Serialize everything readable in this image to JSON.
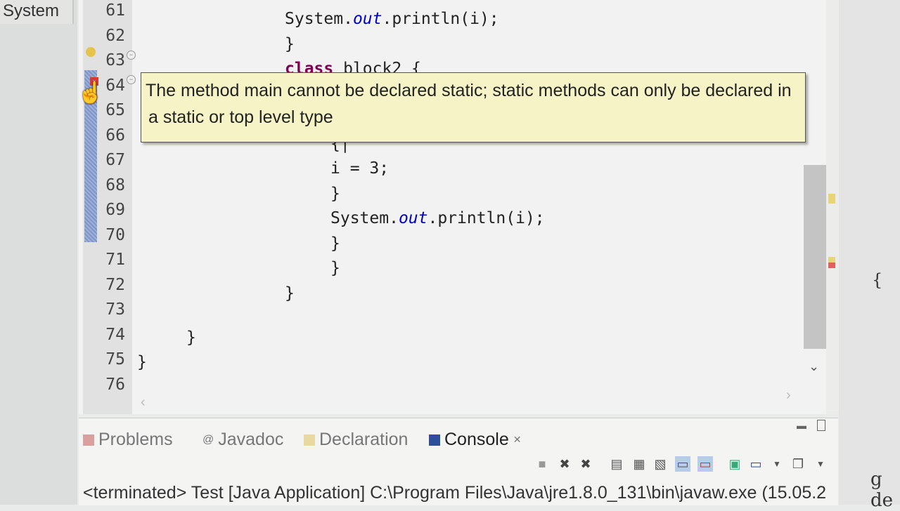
{
  "left_tab": "System",
  "editor": {
    "lines": [
      {
        "n": "61",
        "code": [
          [
            "",
            "System."
          ],
          [
            "fld",
            "out"
          ],
          [
            "",
            ".println(i);"
          ]
        ],
        "indent": 405
      },
      {
        "n": "62",
        "code": [
          [
            "",
            "}"
          ]
        ],
        "indent": 405
      },
      {
        "n": "63",
        "code": [
          [
            "kw",
            "class"
          ],
          [
            "",
            " block2 {"
          ]
        ],
        "indent": 405
      },
      {
        "n": "64",
        "code": [],
        "indent": 405
      },
      {
        "n": "65",
        "code": [],
        "indent": 405
      },
      {
        "n": "66",
        "code": [
          [
            "",
            "{|"
          ]
        ],
        "indent": 470
      },
      {
        "n": "67",
        "code": [
          [
            "",
            "i = 3;"
          ]
        ],
        "indent": 470
      },
      {
        "n": "68",
        "code": [
          [
            "",
            "}"
          ]
        ],
        "indent": 470
      },
      {
        "n": "69",
        "code": [
          [
            "",
            "System."
          ],
          [
            "fld",
            "out"
          ],
          [
            "",
            ".println(i);"
          ]
        ],
        "indent": 470
      },
      {
        "n": "70",
        "code": [
          [
            "",
            "}"
          ]
        ],
        "indent": 470
      },
      {
        "n": "71",
        "code": [
          [
            "",
            "}"
          ]
        ],
        "indent": 470
      },
      {
        "n": "72",
        "code": [
          [
            "",
            "}"
          ]
        ],
        "indent": 405
      },
      {
        "n": "73",
        "code": [],
        "indent": 405
      },
      {
        "n": "74",
        "code": [
          [
            "",
            "}"
          ]
        ],
        "indent": 265
      },
      {
        "n": "75",
        "code": [
          [
            "",
            "}"
          ]
        ],
        "indent": 195
      },
      {
        "n": "76",
        "code": [],
        "indent": 195
      }
    ],
    "tooltip_line1": "The method main cannot be declared static; static methods can only be declared in",
    "tooltip_line2": "a static or top level type"
  },
  "bottom_panel": {
    "tabs": [
      {
        "label": "Problems",
        "icon": "problems-icon"
      },
      {
        "label": "Javadoc",
        "icon": "at-icon"
      },
      {
        "label": "Declaration",
        "icon": "declaration-icon"
      },
      {
        "label": "Console",
        "icon": "console-icon",
        "close": "✕"
      }
    ],
    "status": "<terminated> Test [Java Application] C:\\Program Files\\Java\\jre1.8.0_131\\bin\\javaw.exe (15.05.2"
  },
  "right_fragment": "g de"
}
